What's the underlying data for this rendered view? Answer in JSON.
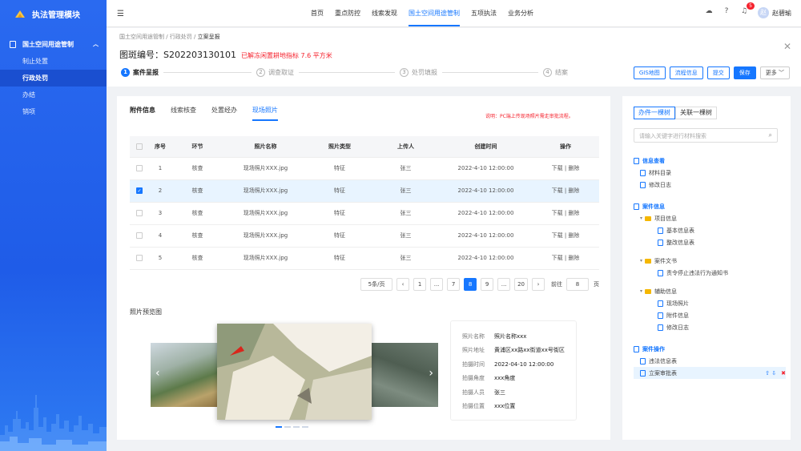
{
  "app": {
    "title": "执法管理模块"
  },
  "sidebar": {
    "group": "国土空间用途管制",
    "items": [
      "制止处置",
      "行政处罚",
      "办结",
      "销项"
    ],
    "active": "行政处罚"
  },
  "topnav": [
    "首页",
    "重点防控",
    "线索发现",
    "国土空间用途管制",
    "五项执法",
    "业务分析"
  ],
  "topnav_active": "国土空间用途管制",
  "topbar": {
    "badge": "5",
    "user": "赵碧瑜",
    "avatar": "赵"
  },
  "breadcrumb": [
    "国土空间用途管制",
    "行政处罚",
    "立案呈报"
  ],
  "page_title": "图斑编号：S202203130101",
  "title_warn": "已解冻闲置耕地指标 7.6 平方米",
  "steps": [
    {
      "num": "1",
      "label": "案件呈报"
    },
    {
      "num": "2",
      "label": "调查取证"
    },
    {
      "num": "3",
      "label": "处罚填报"
    },
    {
      "num": "4",
      "label": "结案"
    }
  ],
  "actions": [
    "GIS地图",
    "流程信息",
    "提交",
    "保存",
    "更多"
  ],
  "tabs": [
    "附件信息",
    "线索核查",
    "处置经办",
    "现场照片"
  ],
  "note": "说明：PC端上传现场照片需走审批流程。",
  "table": {
    "headers": [
      "序号",
      "环节",
      "照片名称",
      "照片类型",
      "上传人",
      "创建时间",
      "操作"
    ],
    "rows": [
      [
        "1",
        "核查",
        "现场照片XXX.jpg",
        "特征",
        "张三",
        "2022-4-10  12:00:00"
      ],
      [
        "2",
        "核查",
        "现场照片XXX.jpg",
        "特征",
        "张三",
        "2022-4-10  12:00:00"
      ],
      [
        "3",
        "核查",
        "现场照片XXX.jpg",
        "特征",
        "张三",
        "2022-4-10  12:00:00"
      ],
      [
        "4",
        "核查",
        "现场照片XXX.jpg",
        "特征",
        "张三",
        "2022-4-10  12:00:00"
      ],
      [
        "5",
        "核查",
        "现场照片XXX.jpg",
        "特征",
        "张三",
        "2022-4-10  12:00:00"
      ]
    ],
    "op_download": "下载",
    "op_sep": " | ",
    "op_delete": "删除",
    "selected_row": 2
  },
  "pager": {
    "size": "5条/页",
    "prev": "‹",
    "pages": [
      "1",
      "...",
      "7",
      "8",
      "9",
      "...",
      "20"
    ],
    "active": "8",
    "next": "›",
    "goto": "前往",
    "goto_value": "8",
    "unit": "页"
  },
  "preview": {
    "title": "照片预览图",
    "arrow_left": "‹",
    "arrow_right": "›"
  },
  "photo_info": [
    {
      "k": "照片名称",
      "v": "照片名称xxx"
    },
    {
      "k": "照片地址",
      "v": "黄浦区xx路xx街道xx号街区"
    },
    {
      "k": "拍摄时间",
      "v": "2022-04-10 12:00:00"
    },
    {
      "k": "拍摄角度",
      "v": "xxx角度"
    },
    {
      "k": "拍摄人员",
      "v": "张三"
    },
    {
      "k": "拍摄位置",
      "v": "xxx位置"
    }
  ],
  "right": {
    "tabs": [
      "办件一棵树",
      "关联一棵树"
    ],
    "search_placeholder": "请输入关键字进行材料搜索",
    "sections": [
      {
        "title": "信息查看",
        "children": [
          {
            "label": "材料目录"
          },
          {
            "label": "修改日志"
          }
        ]
      },
      {
        "title": "案件信息",
        "folders": [
          {
            "label": "项目信息",
            "children": [
              "基本信息表",
              "整改信息表"
            ]
          },
          {
            "label": "案件文书",
            "children": [
              "责令停止违法行为通知书"
            ]
          },
          {
            "label": "辅助信息",
            "children": [
              "现场照片",
              "附件信息",
              "修改日志"
            ]
          }
        ]
      },
      {
        "title": "案件操作",
        "children": [
          {
            "label": "违法信息表"
          },
          {
            "label": "立案审批表"
          }
        ]
      }
    ]
  },
  "colors": {
    "primary": "#1677ff",
    "danger": "#f5222d",
    "sidebar": "#2a6af0"
  }
}
